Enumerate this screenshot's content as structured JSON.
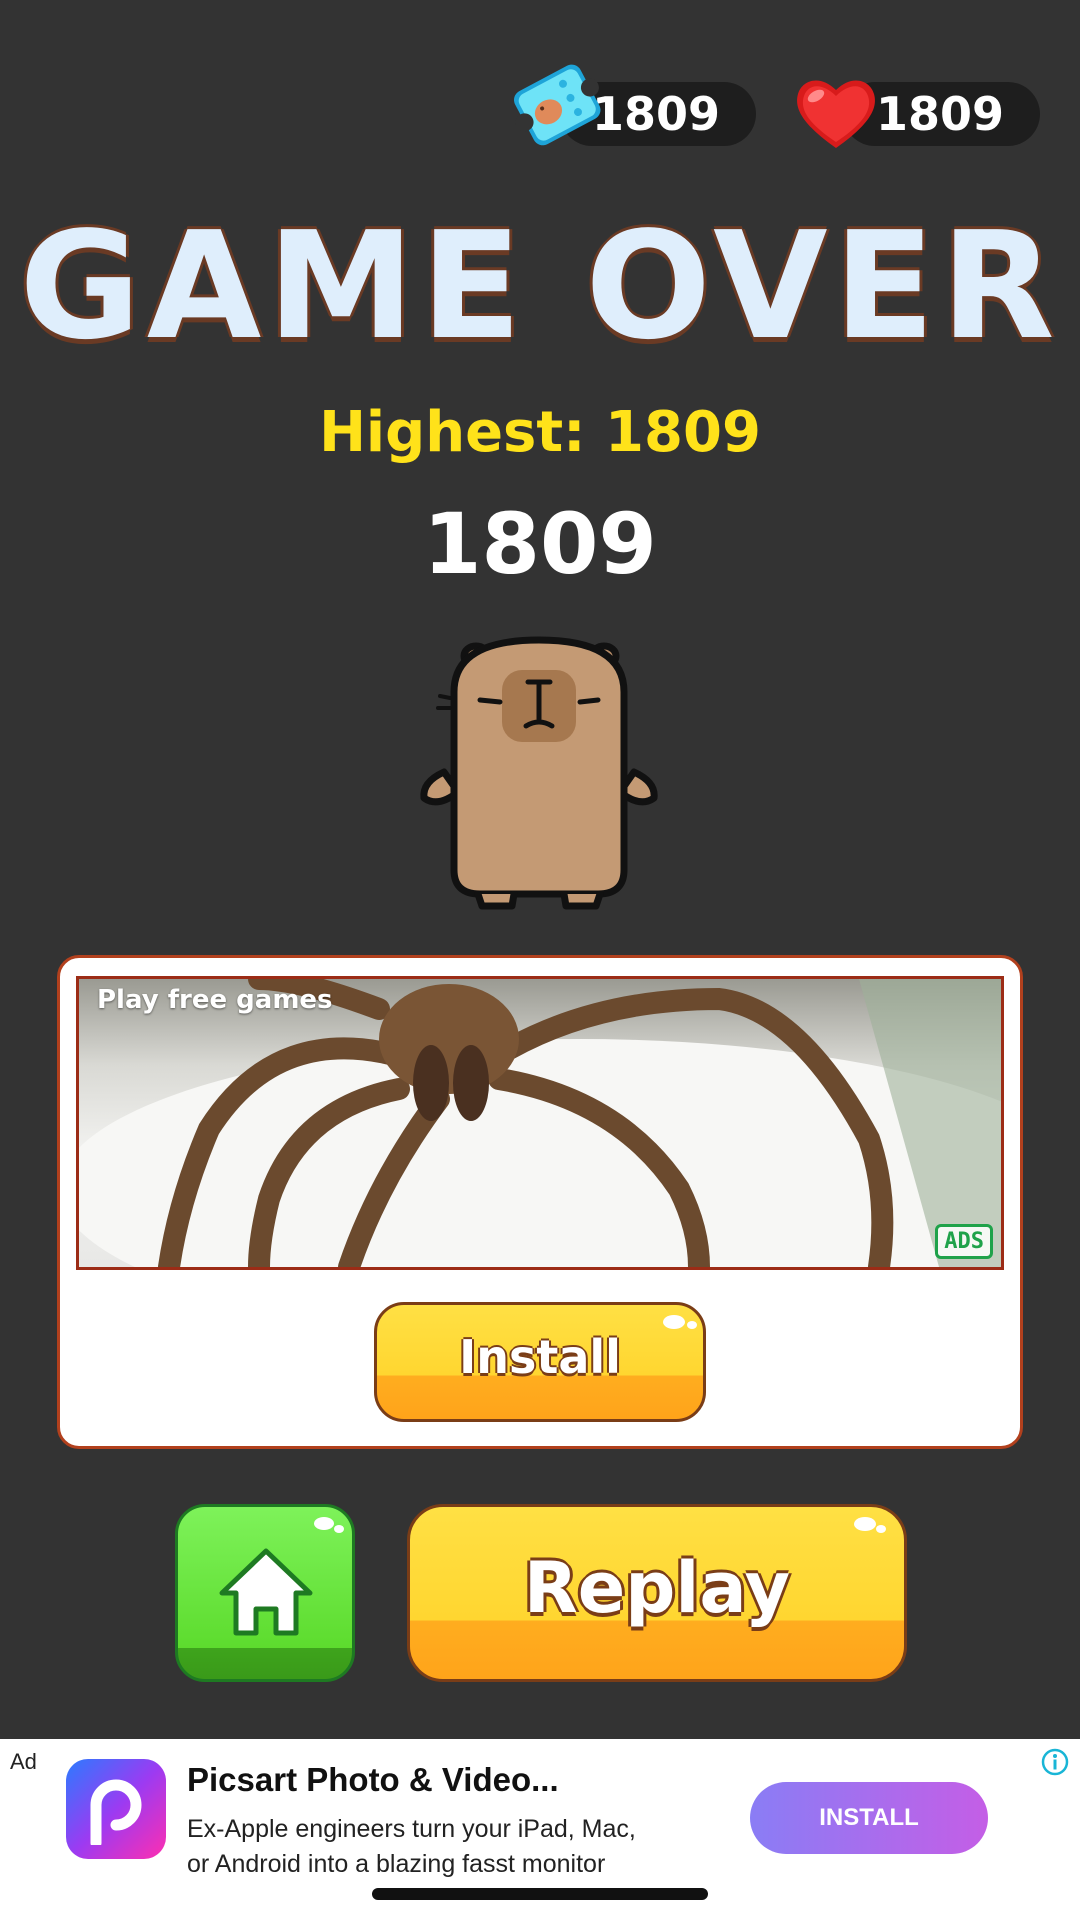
{
  "colors": {
    "background": "#333333",
    "title": "#dfeefc",
    "highest": "#ffe21a",
    "score": "#ffffff",
    "yellow_button": "#ffd630",
    "green_button": "#5ddc2e",
    "outline": "#7a3d17",
    "ad_border": "#b2401d",
    "banner_install": "#a96cef"
  },
  "hud": {
    "tickets": "1809",
    "lives": "1809",
    "ticket_icon": "ticket-icon",
    "lives_icon": "heart-icon"
  },
  "result": {
    "title": "GAME OVER",
    "highest": "Highest: 1809",
    "score": "1809"
  },
  "character": {
    "icon": "capybara-mascot"
  },
  "ad_card": {
    "image_label": "Play free games",
    "badge": "ADS",
    "install_label": "Install"
  },
  "actions": {
    "home_icon": "home-icon",
    "replay_label": "Replay"
  },
  "banner_ad": {
    "ad_label": "Ad",
    "app_icon": "picsart-app-icon",
    "app_icon_letter": "P",
    "title": "Picsart Photo & Video...",
    "description_line1": "Ex-Apple engineers turn your iPad, Mac,",
    "description_line2": "or Android into a blazing fasst monitor",
    "install_label": "INSTALL",
    "info_icon": "info-icon"
  }
}
